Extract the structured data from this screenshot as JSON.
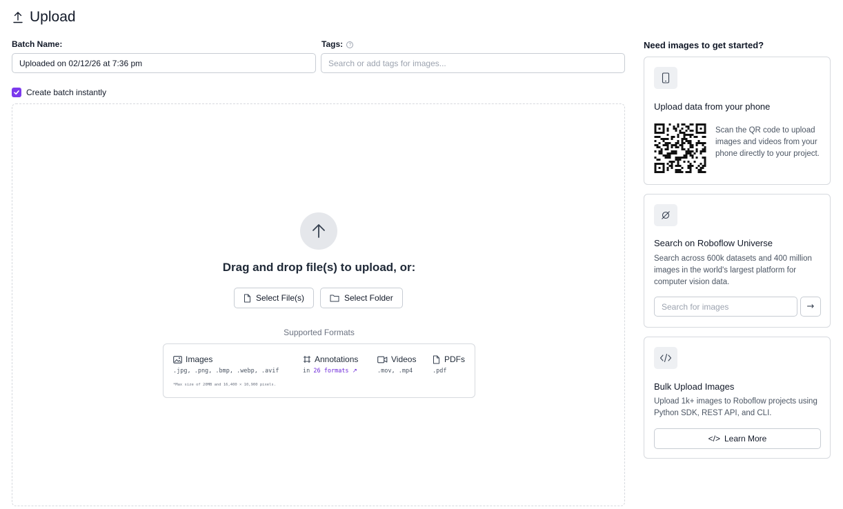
{
  "header": {
    "title": "Upload",
    "icon": "upload-icon"
  },
  "form": {
    "batch_label": "Batch Name:",
    "batch_value": "Uploaded on 02/12/26 at 7:36 pm",
    "tags_label": "Tags:",
    "tags_help_icon": "help-circle-icon",
    "tags_placeholder": "Search or add tags for images...",
    "create_batch_label": "Create batch instantly",
    "create_batch_checked": true
  },
  "dropzone": {
    "title": "Drag and drop file(s) to upload, or:",
    "select_files_label": "Select File(s)",
    "select_folder_label": "Select Folder",
    "supported_label": "Supported Formats",
    "formats": [
      {
        "icon": "image-icon",
        "title": "Images",
        "ext": ".jpg, .png, .bmp, .webp, .avif"
      },
      {
        "icon": "bounding-box-icon",
        "title": "Annotations",
        "ext_prefix": "in",
        "ext_link": "26 formats"
      },
      {
        "icon": "video-icon",
        "title": "Videos",
        "ext": ".mov, .mp4"
      },
      {
        "icon": "pdf-file-icon",
        "title": "PDFs",
        "ext": ".pdf"
      }
    ],
    "note": "*Max size of 20MB and 16,400 × 10,900 pixels."
  },
  "sidebar": {
    "title": "Need images to get started?",
    "phone_card": {
      "icon": "phone-icon",
      "title": "Upload data from your phone",
      "desc": "Scan the QR code to upload images and videos from your phone directly to your project."
    },
    "universe_card": {
      "icon": "planet-icon",
      "title": "Search on Roboflow Universe",
      "desc": "Search across 600k datasets and 400 million images in the world's largest platform for computer vision data.",
      "search_placeholder": "Search for images",
      "arrow": "→"
    },
    "bulk_card": {
      "icon": "code-icon",
      "title": "Bulk Upload Images",
      "desc": "Upload 1k+ images to Roboflow projects using Python SDK, REST API, and CLI.",
      "button_label": "Learn More",
      "button_icon_text": "</>"
    }
  },
  "colors": {
    "accent": "#7c3aed",
    "link": "#6d28d9",
    "border": "#d6d9de"
  }
}
